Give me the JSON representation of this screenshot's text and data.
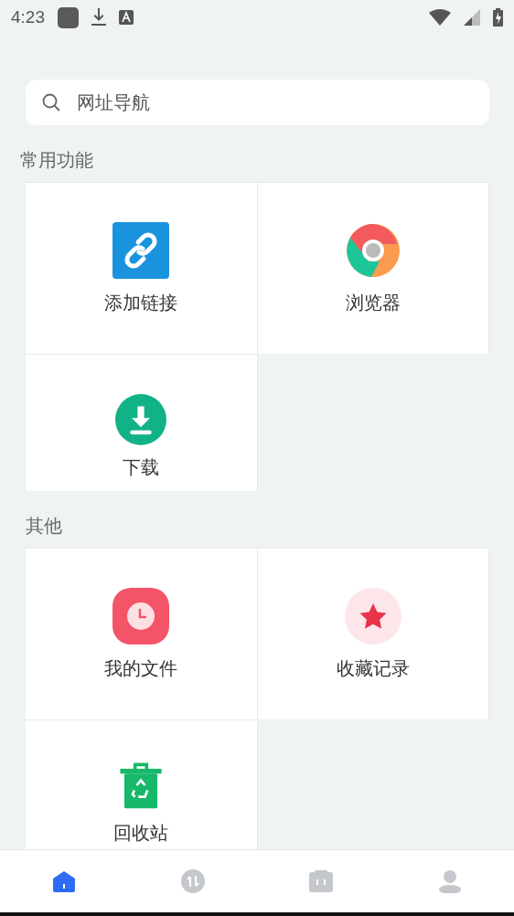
{
  "status_bar": {
    "time": "4:23"
  },
  "search": {
    "placeholder": "网址导航"
  },
  "sections": [
    {
      "title": "常用功能",
      "items": [
        {
          "label": "添加链接",
          "kind": "link"
        },
        {
          "label": "浏览器",
          "kind": "browser"
        },
        {
          "label": "下载",
          "kind": "download"
        }
      ]
    },
    {
      "title": "其他",
      "items": [
        {
          "label": "我的文件",
          "kind": "clock"
        },
        {
          "label": "收藏记录",
          "kind": "star"
        },
        {
          "label": "回收站",
          "kind": "recycle"
        }
      ]
    }
  ],
  "tabs": [
    {
      "kind": "home",
      "selected": true
    },
    {
      "kind": "transfer",
      "selected": false
    },
    {
      "kind": "box",
      "selected": false
    },
    {
      "kind": "profile",
      "selected": false
    }
  ]
}
